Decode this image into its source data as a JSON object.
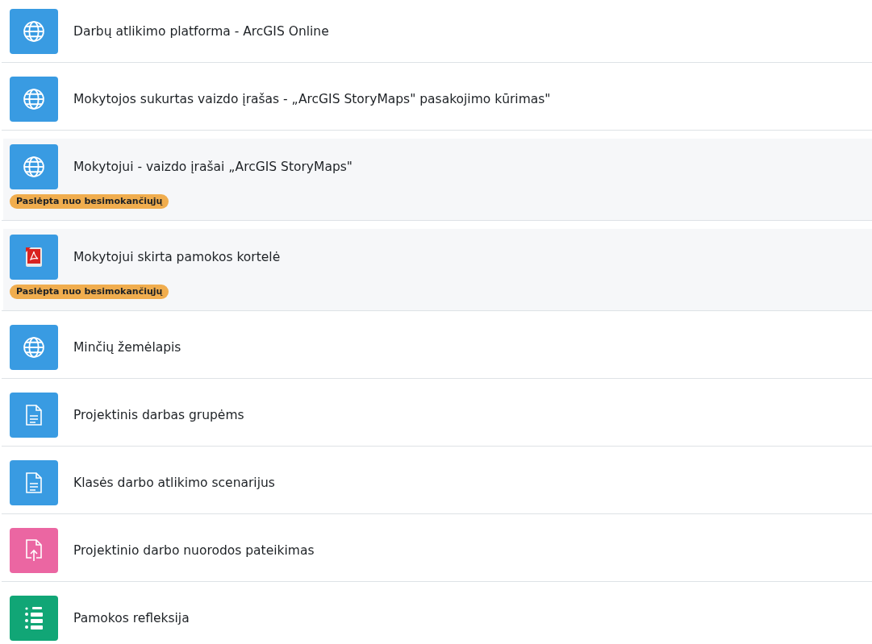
{
  "activities": [
    {
      "kind": "url",
      "title": "Darbų atlikimo platforma - ArcGIS Online",
      "hidden": false
    },
    {
      "kind": "url",
      "title": "Mokytojos sukurtas vaizdo įrašas - „ArcGIS StoryMaps\" pasakojimo kūrimas\"",
      "hidden": false
    },
    {
      "kind": "url",
      "title": "Mokytojui - vaizdo įrašai „ArcGIS StoryMaps\"",
      "hidden": true,
      "badge": "Paslėpta nuo besimokančiųjų"
    },
    {
      "kind": "pdf",
      "title": "Mokytojui skirta pamokos kortelė",
      "hidden": true,
      "badge": "Paslėpta nuo besimokančiųjų"
    },
    {
      "kind": "url",
      "title": "Minčių žemėlapis",
      "hidden": false
    },
    {
      "kind": "page",
      "title": "Projektinis darbas grupėms",
      "hidden": false
    },
    {
      "kind": "page",
      "title": "Klasės darbo atlikimo scenarijus",
      "hidden": false
    },
    {
      "kind": "assign",
      "title": "Projektinio darbo nuorodos pateikimas",
      "hidden": false
    },
    {
      "kind": "feedback",
      "title": "Pamokos refleksija",
      "hidden": false
    }
  ]
}
